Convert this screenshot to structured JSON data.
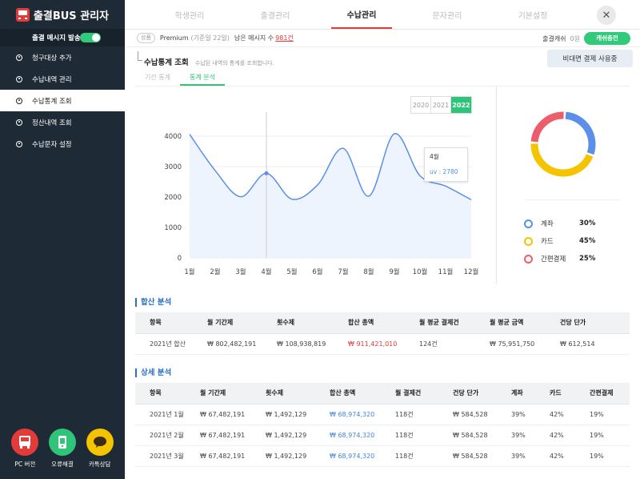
{
  "app": {
    "title": "출결BUS 관리자"
  },
  "sidebar": {
    "alarm_label": "출결 메시지 발송",
    "items": [
      {
        "label": "청구대상 추가"
      },
      {
        "label": "수납내역 관리"
      },
      {
        "label": "수납통계 조회"
      },
      {
        "label": "정산내역 조회"
      },
      {
        "label": "수납문자 설정"
      }
    ],
    "bottom": [
      {
        "label": "PC 버전",
        "color": "#e33a3a",
        "icon": "bus-icon"
      },
      {
        "label": "오류해결",
        "color": "#2ec47a",
        "icon": "chat-icon"
      },
      {
        "label": "카톡상담",
        "color": "#f5c400",
        "icon": "kakao-icon"
      }
    ]
  },
  "tabs": [
    "학생관리",
    "출결관리",
    "수납관리",
    "문자관리",
    "기본설정"
  ],
  "infobar": {
    "tag": "상품",
    "plan": "Premium",
    "days": "(기준일 22일)",
    "remain_label": "남은 메시지 수",
    "remain_value": "981건",
    "cash_label": "출결캐쉬",
    "cash_value": "0원",
    "charge_btn": "캐쉬충전"
  },
  "section": {
    "title": "수납통계 조회",
    "desc": "수납된 내역의 통계를 조회합니다.",
    "unpaid_btn": "비대면 결제 사용중",
    "subtabs": [
      "기간 통계",
      "통계 분석"
    ]
  },
  "chart_data": {
    "type": "line",
    "years": [
      "2020",
      "2021",
      "2022"
    ],
    "selected_year": "2022",
    "categories": [
      "1월",
      "2월",
      "3월",
      "4월",
      "5월",
      "6월",
      "7월",
      "8월",
      "9월",
      "10월",
      "11월",
      "12월"
    ],
    "values": [
      4060,
      2870,
      2010,
      2780,
      1930,
      2400,
      3600,
      2030,
      4080,
      2700,
      2360,
      1910
    ],
    "yticks": [
      "0",
      "1000",
      "2000",
      "3000",
      "4000"
    ],
    "ylim": [
      0,
      4000
    ],
    "tooltip": {
      "month": "4월",
      "label": "uv : 2780"
    },
    "line_color": "#5b8fe8",
    "pie": [
      {
        "name": "계좌",
        "pct": "30%",
        "value": 30,
        "color": "#5b8fe8"
      },
      {
        "name": "카드",
        "pct": "45%",
        "value": 45,
        "color": "#f5c400"
      },
      {
        "name": "간편결제",
        "pct": "25%",
        "value": 25,
        "color": "#ec5f6a"
      }
    ]
  },
  "summary": {
    "title": "합산 분석",
    "headers": [
      "항목",
      "월 기간제",
      "횟수제",
      "합산 총액",
      "월 평균 결제건",
      "월 평균 금액",
      "건당 단가"
    ],
    "row": [
      "2021년 합산",
      "₩ 802,482,191",
      "₩ 108,938,819",
      "₩ 911,421,010",
      "124건",
      "₩ 75,951,750",
      "₩ 612,514"
    ]
  },
  "detail": {
    "title": "상세 분석",
    "headers": [
      "항목",
      "월 기간제",
      "횟수제",
      "합산 총액",
      "월 결제건",
      "건당 단가",
      "계좌",
      "카드",
      "간편결제"
    ],
    "rows": [
      [
        "2021년 1월",
        "₩ 67,482,191",
        "₩ 1,492,129",
        "₩ 68,974,320",
        "118건",
        "₩ 584,528",
        "39%",
        "42%",
        "19%"
      ],
      [
        "2021년 2월",
        "₩ 67,482,191",
        "₩ 1,492,129",
        "₩ 68,974,320",
        "118건",
        "₩ 584,528",
        "39%",
        "42%",
        "19%"
      ],
      [
        "2021년 3월",
        "₩ 67,482,191",
        "₩ 1,492,129",
        "₩ 68,974,320",
        "118건",
        "₩ 584,528",
        "39%",
        "42%",
        "19%"
      ]
    ]
  }
}
